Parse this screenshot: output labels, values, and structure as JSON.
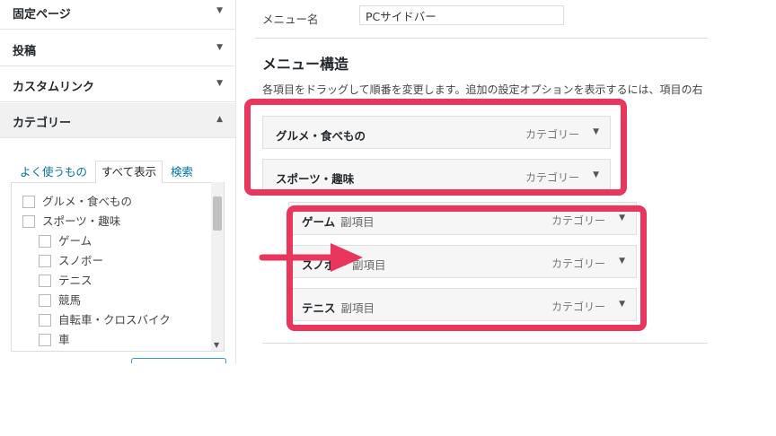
{
  "sidebar": {
    "sections": [
      {
        "label": "固定ページ"
      },
      {
        "label": "投稿"
      },
      {
        "label": "カスタムリンク"
      },
      {
        "label": "カテゴリー"
      }
    ],
    "tabs": [
      "よく使うもの",
      "すべて表示",
      "検索"
    ],
    "active_tab": "すべて表示",
    "categories": [
      {
        "label": "グルメ・食べもの"
      },
      {
        "label": "スポーツ・趣味"
      },
      {
        "label": "ゲーム"
      },
      {
        "label": "スノボー"
      },
      {
        "label": "テニス"
      },
      {
        "label": "競馬"
      },
      {
        "label": "自転車・クロスバイク"
      },
      {
        "label": "車"
      }
    ]
  },
  "menu": {
    "name_label": "メニュー名",
    "name_value": "PCサイドバー",
    "structure_title": "メニュー構造",
    "structure_desc": "各項目をドラッグして順番を変更します。追加の設定オプションを表示するには、項目の右",
    "items": [
      {
        "title": "グルメ・食べもの",
        "sub": "",
        "type": "カテゴリー"
      },
      {
        "title": "スポーツ・趣味",
        "sub": "",
        "type": "カテゴリー"
      },
      {
        "title": "ゲーム",
        "sub": "副項目",
        "type": "カテゴリー"
      },
      {
        "title": "スノボー",
        "sub": "副項目",
        "type": "カテゴリー"
      },
      {
        "title": "テニス",
        "sub": "副項目",
        "type": "カテゴリー"
      }
    ]
  },
  "colors": {
    "highlight": "#e8365d",
    "link": "#0073aa"
  },
  "icons": {
    "collapse": "triangle-down-icon",
    "expand": "triangle-up-icon",
    "annotation": "arrow-right-icon"
  }
}
